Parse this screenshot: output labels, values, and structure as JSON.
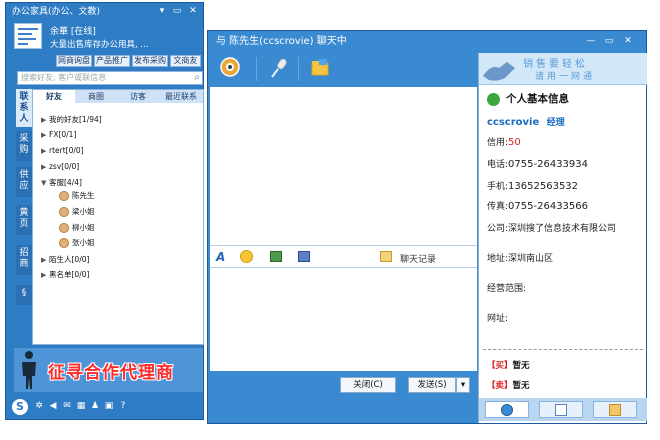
{
  "left_window": {
    "title": "办公家具(办公、文教)",
    "controls": {
      "minimize": "▾",
      "restore": "▭",
      "close": "✕"
    },
    "user": {
      "name": "余華 [在线]",
      "signature": "大量出售库存办公用具, ..."
    },
    "buttons": [
      "网商询盘",
      "产品推广",
      "发布采购",
      "文商友"
    ],
    "search_placeholder": "搜索好友, 客户或联信息",
    "side_tabs": [
      "联系人",
      "采购",
      "供应",
      "黄页",
      "招商",
      "§"
    ],
    "contact_tabs": [
      "好友",
      "商圈",
      "访客",
      "最近联系"
    ],
    "groups": [
      {
        "label": "我的好友[1/94]"
      },
      {
        "label": "FX[0/1]"
      },
      {
        "label": "rtert[0/0]"
      },
      {
        "label": "zsv[0/0]"
      },
      {
        "label": "客服[4/4]"
      }
    ],
    "friends": [
      "陈先生",
      "梁小姐",
      "柳小姐",
      "张小姐"
    ],
    "groups_after": [
      "陌生人[0/0]",
      "黑名单[0/0]"
    ],
    "banner_text": "征寻合作代理商"
  },
  "chat_window": {
    "title": "与 陈先生(ccscrovie) 聊天中",
    "controls": {
      "minimize": "—",
      "restore": "▭",
      "close": "✕"
    },
    "history_label": "聊天记录",
    "close_label": "关闭(C)",
    "send_label": "发送(S)",
    "send_dropdown": "▾"
  },
  "info_panel": {
    "banner_line1": "销售要轻松",
    "banner_line2": "请用一网通",
    "heading": "个人基本信息",
    "name": "ccscrovie",
    "position": "经理",
    "credit_label": "信用:",
    "credit_value": "50",
    "phone_label": "电话:",
    "phone_value": "0755-26433934",
    "mobile_label": "手机:",
    "mobile_value": "13652563532",
    "fax_label": "传真:",
    "fax_value": "0755-26433566",
    "company_label": "公司:",
    "company_value": "深圳搜了信息技术有限公司",
    "address_label": "地址:",
    "address_value": "深圳南山区",
    "scope_label": "经营范围:",
    "website_label": "网址:",
    "buy_tag": "【买】",
    "buy_value": "暂无",
    "sell_tag": "【卖】",
    "sell_value": "暂无"
  },
  "colors": {
    "window_blue": "#2e7cc4",
    "chat_blue": "#3a8ad2",
    "accent_red": "#d22222",
    "name_blue": "#1d6bc1"
  }
}
